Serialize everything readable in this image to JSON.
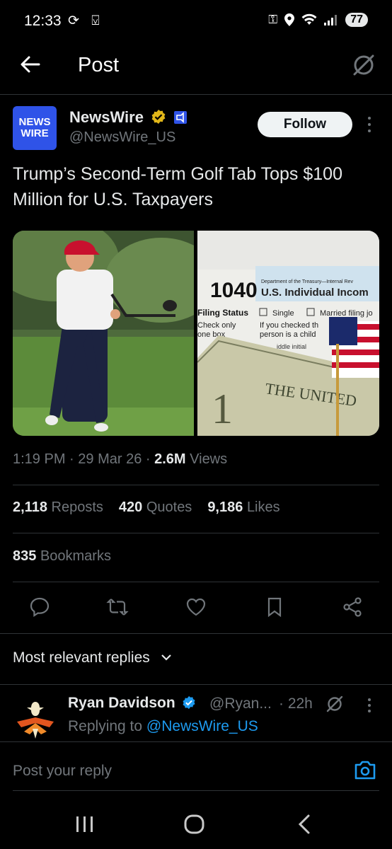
{
  "status_bar": {
    "time": "12:33",
    "left_icons": "⟳ ⍌",
    "battery": "77"
  },
  "header": {
    "title": "Post"
  },
  "author": {
    "logo_line1": "NEWS",
    "logo_line2": "WIRE",
    "name": "NewsWire",
    "handle": "@NewsWire_US",
    "follow_label": "Follow"
  },
  "post": {
    "text": "Trump’s Second-Term Golf Tab Tops $100 Million for U.S. Taxpayers"
  },
  "media": {
    "form_number": "1040",
    "form_dept": "Department of the Treasury—Internal Rev",
    "form_title": "U.S. Individual Incom",
    "filing_status": "Filing Status",
    "single": "Single",
    "married": "Married filing jo",
    "check_only": "Check only",
    "one_box": "one box",
    "if_checked": "If you checked th",
    "person_child": "person is a child",
    "middle_initial": "iddle initial",
    "bill_text": "THE UNITED"
  },
  "meta": {
    "time": "1:19 PM",
    "date": "29 Mar 26",
    "views_count": "2.6M",
    "views_label": "Views"
  },
  "stats": {
    "reposts_count": "2,118",
    "reposts_label": "Reposts",
    "quotes_count": "420",
    "quotes_label": "Quotes",
    "likes_count": "9,186",
    "likes_label": "Likes",
    "bookmarks_count": "835",
    "bookmarks_label": "Bookmarks"
  },
  "actions": [
    "reply-icon",
    "repost-icon",
    "like-icon",
    "bookmark-icon",
    "share-icon"
  ],
  "replies": {
    "sort_label": "Most relevant replies",
    "first": {
      "name": "Ryan Davidson",
      "handle": "@Ryan...",
      "time": "· 22h",
      "replying_prefix": "Replying to",
      "replying_handle": "@NewsWire_US"
    }
  },
  "composer": {
    "placeholder": "Post your reply"
  },
  "colors": {
    "accent": "#1d9bf0",
    "verified": "#e2b719",
    "muted": "#71767b",
    "background": "#000000"
  }
}
